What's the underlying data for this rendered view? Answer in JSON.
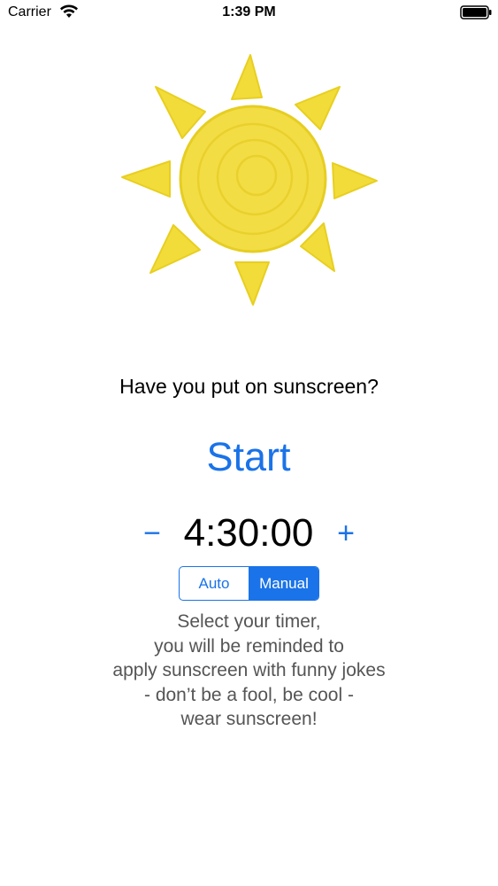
{
  "status_bar": {
    "carrier": "Carrier",
    "time": "1:39 PM",
    "icons": [
      "wifi-icon",
      "battery-icon"
    ]
  },
  "illustration": {
    "icon": "sun-illustration",
    "color": "#f2dc3a"
  },
  "main": {
    "question": "Have you put on sunscreen?",
    "start_label": "Start",
    "timer": {
      "minus_label": "−",
      "value": "4:30:00",
      "plus_label": "+"
    },
    "mode": {
      "options": [
        "Auto",
        "Manual"
      ],
      "selected": "Manual"
    },
    "description_lines": [
      "Select your timer,",
      "you will be reminded to",
      "apply sunscreen with funny jokes",
      "- don’t be a fool, be cool -",
      "wear sunscreen!"
    ]
  },
  "colors": {
    "accent": "#1a73e8",
    "text": "#000000",
    "secondary_text": "#555555",
    "background": "#ffffff"
  }
}
